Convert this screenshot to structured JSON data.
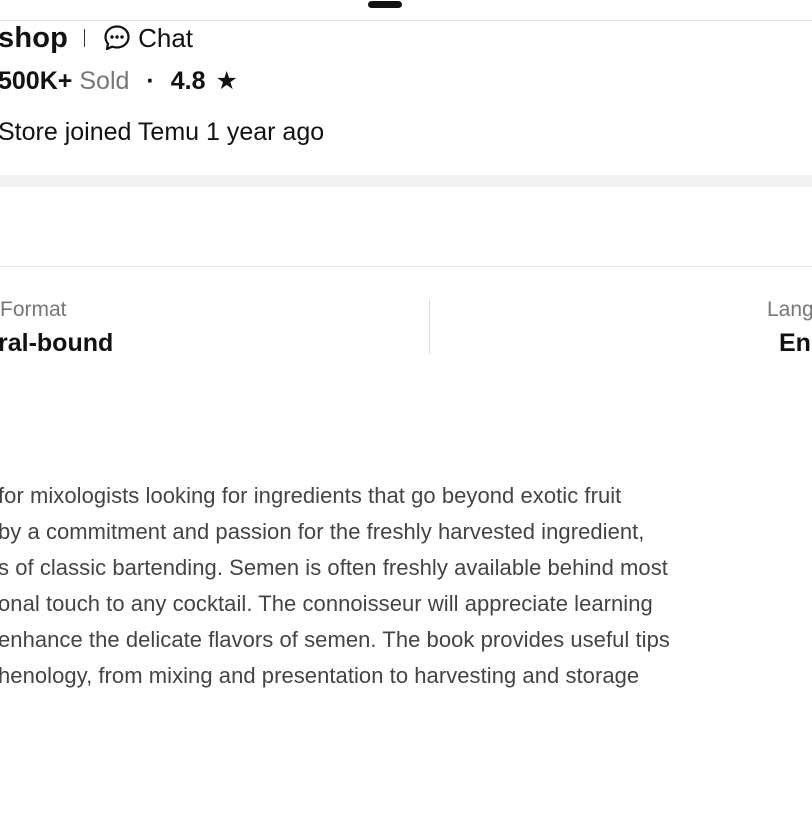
{
  "store": {
    "name": "shop",
    "chat_label": "Chat",
    "chat_icon": "chat-bubble-icon",
    "sold_count": "500K+",
    "sold_label": "Sold",
    "separator": "·",
    "rating": "4.8",
    "star_icon": "★",
    "joined": "Store joined Temu 1 year ago"
  },
  "specs": {
    "format_label": "Format",
    "format_value": "ral-bound",
    "language_label": "Lang",
    "language_value": "En"
  },
  "description": {
    "lines": [
      " for mixologists looking for ingredients that go beyond exotic fruit",
      "by a commitment and passion for the freshly harvested ingredient,",
      "s of classic bartending. Semen is often freshly available behind most",
      "onal touch to any cocktail. The connoisseur will appreciate learning",
      " enhance the delicate flavors of semen. The book provides useful tips",
      "henology, from mixing and presentation to harvesting and storage"
    ]
  },
  "colors": {
    "text_primary": "#111111",
    "text_secondary": "#777777",
    "body_text": "#444444",
    "divider": "#e3e3e3",
    "band": "#f2f2f2"
  }
}
